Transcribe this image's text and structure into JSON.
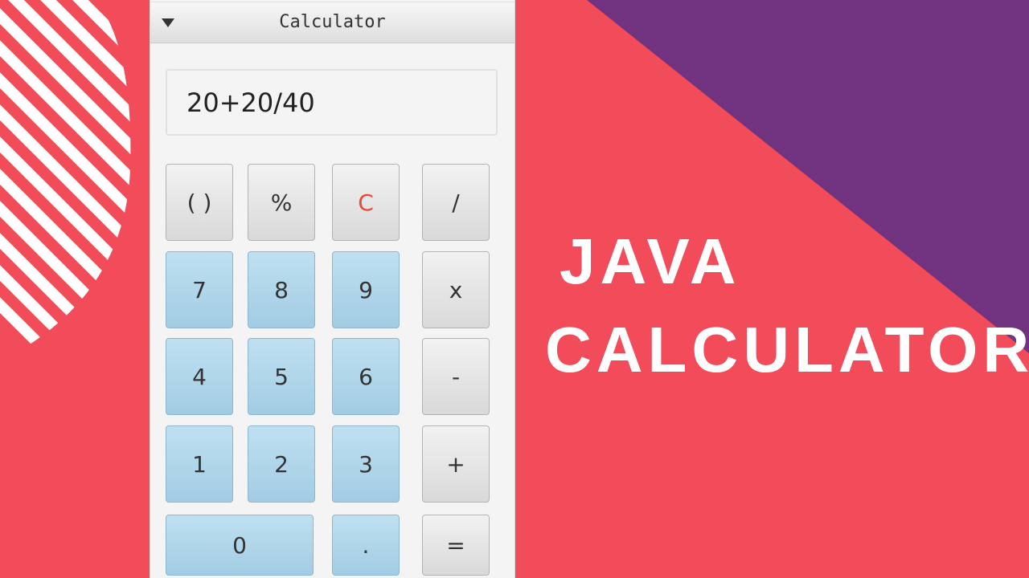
{
  "colors": {
    "background": "#f24b5a",
    "accent_purple": "#713380",
    "stripes": "#ffffff",
    "digit_button": "#a9d2e8",
    "clear_text": "#e8473b"
  },
  "window": {
    "title": "Calculator",
    "collapse_icon": "triangle-down"
  },
  "display": {
    "value": "20+20/40"
  },
  "keypad": {
    "parentheses": "( )",
    "percent": "%",
    "clear": "C",
    "divide": "/",
    "seven": "7",
    "eight": "8",
    "nine": "9",
    "multiply": "x",
    "four": "4",
    "five": "5",
    "six": "6",
    "subtract": "-",
    "one": "1",
    "two": "2",
    "three": "3",
    "add": "+",
    "zero": "0",
    "decimal": ".",
    "equals": "="
  },
  "banner": {
    "line1": "JAVA",
    "line2": "CALCULATOR"
  }
}
